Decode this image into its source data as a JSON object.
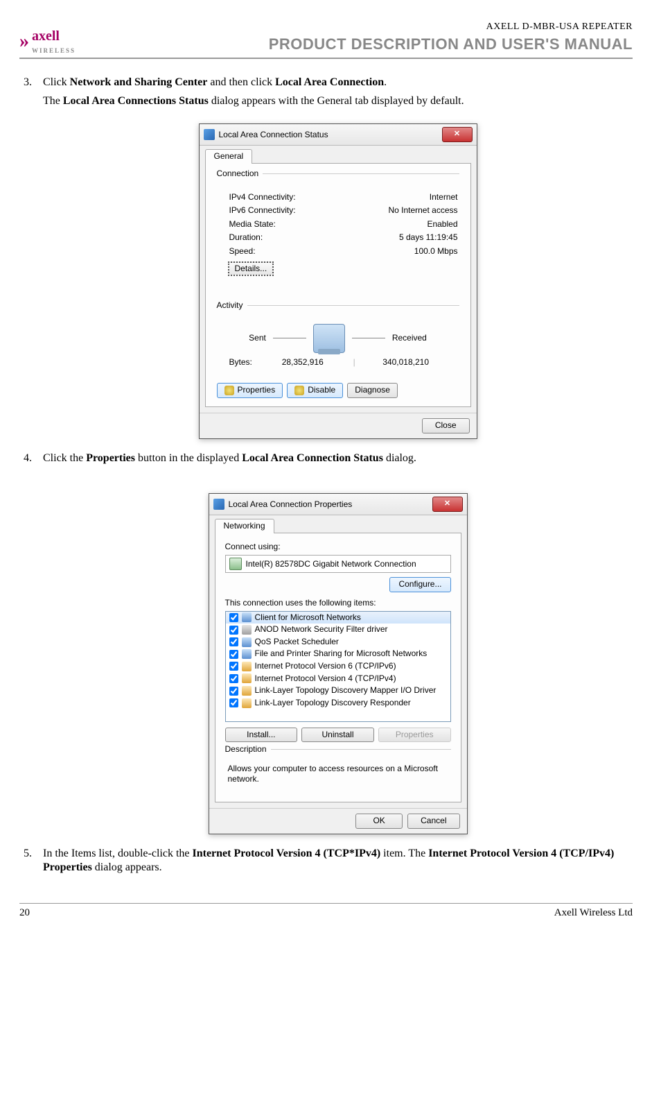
{
  "header": {
    "brand_top": "axell",
    "brand_bottom": "WIRELESS",
    "line1": "AXELL D-MBR-USA REPEATER",
    "line2": "PRODUCT DESCRIPTION AND USER'S MANUAL"
  },
  "steps": {
    "s3": {
      "pre": "Click ",
      "b1": "Network and Sharing Center",
      "mid": " and then click ",
      "b2": "Local Area Connection",
      "post": ".",
      "line2a": "The ",
      "line2b": "Local Area Connections Status",
      "line2c": " dialog appears with the General tab displayed by default."
    },
    "s4": {
      "pre": "Click the ",
      "b1": "Properties",
      "mid": " button in the displayed ",
      "b2": "Local Area Connection Status",
      "post": " dialog."
    },
    "s5": {
      "pre": "In the Items list, double-click the ",
      "b1": "Internet Protocol Version 4 (TCP*IPv4)",
      "mid": " item. The ",
      "b2": "Internet Protocol Version 4 (TCP/IPv4) Properties",
      "post": " dialog appears."
    }
  },
  "dlg1": {
    "title": "Local Area Connection Status",
    "tab": "General",
    "connection_legend": "Connection",
    "rows": [
      {
        "k": "IPv4 Connectivity:",
        "v": "Internet"
      },
      {
        "k": "IPv6 Connectivity:",
        "v": "No Internet access"
      },
      {
        "k": "Media State:",
        "v": "Enabled"
      },
      {
        "k": "Duration:",
        "v": "5 days 11:19:45"
      },
      {
        "k": "Speed:",
        "v": "100.0 Mbps"
      }
    ],
    "details": "Details...",
    "activity_legend": "Activity",
    "sent": "Sent",
    "received": "Received",
    "bytes_label": "Bytes:",
    "bytes_sent": "28,352,916",
    "bytes_recv": "340,018,210",
    "btn_properties": "Properties",
    "btn_disable": "Disable",
    "btn_diagnose": "Diagnose",
    "btn_close": "Close"
  },
  "dlg2": {
    "title": "Local Area Connection Properties",
    "tab": "Networking",
    "connect_using": "Connect using:",
    "nic": "Intel(R) 82578DC Gigabit Network Connection",
    "configure": "Configure...",
    "items_label": "This connection uses the following items:",
    "items": [
      "Client for Microsoft Networks",
      "ANOD Network Security Filter driver",
      "QoS Packet Scheduler",
      "File and Printer Sharing for Microsoft Networks",
      "Internet Protocol Version 6 (TCP/IPv6)",
      "Internet Protocol Version 4 (TCP/IPv4)",
      "Link-Layer Topology Discovery Mapper I/O Driver",
      "Link-Layer Topology Discovery Responder"
    ],
    "btn_install": "Install...",
    "btn_uninstall": "Uninstall",
    "btn_properties": "Properties",
    "desc_legend": "Description",
    "desc_text": "Allows your computer to access resources on a Microsoft network.",
    "btn_ok": "OK",
    "btn_cancel": "Cancel"
  },
  "footer": {
    "page": "20",
    "company": "Axell Wireless Ltd"
  }
}
